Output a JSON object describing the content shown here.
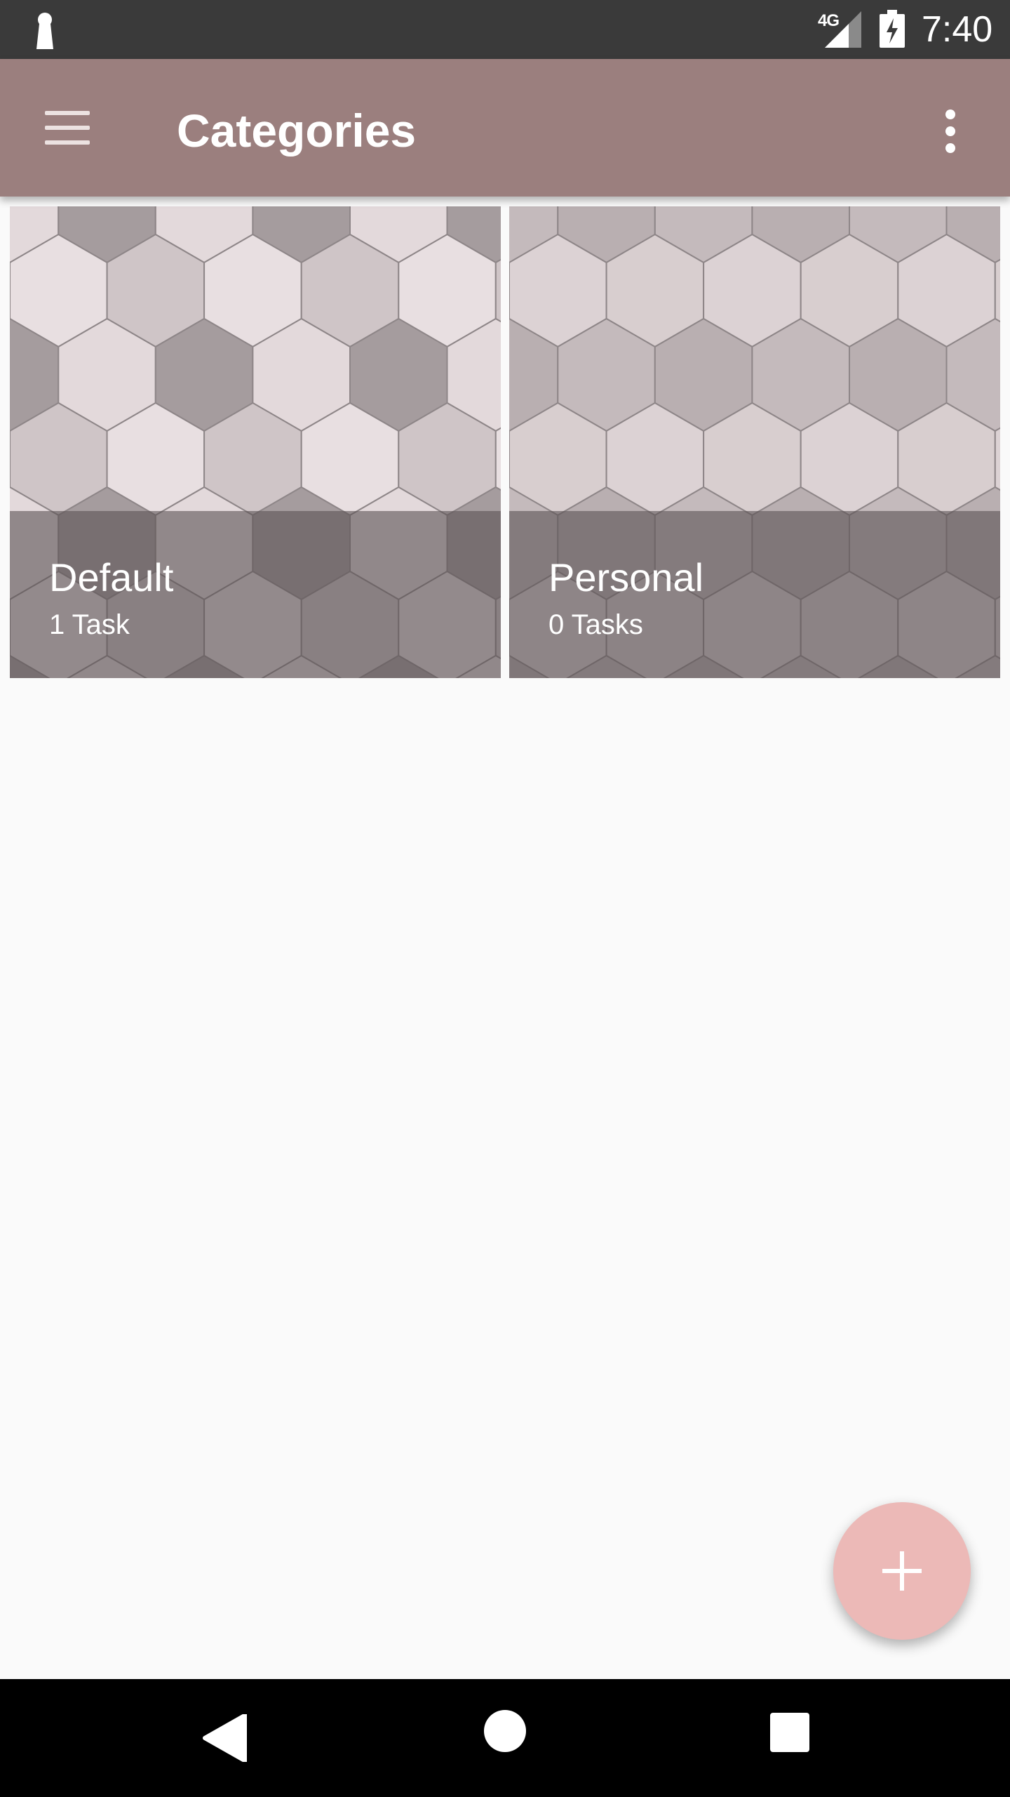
{
  "status_bar": {
    "network": "4G",
    "time": "7:40"
  },
  "app_bar": {
    "title": "Categories"
  },
  "categories": [
    {
      "name": "Default",
      "count": "1 Task"
    },
    {
      "name": "Personal",
      "count": "0 Tasks"
    }
  ],
  "colors": {
    "app_bar": "#9b7f7e",
    "status_bar": "#3a3a3a",
    "fab": "#ecb9b7",
    "background": "#fafafa"
  },
  "icons": {
    "menu": "hamburger-menu-icon",
    "overflow": "more-vert-icon",
    "fab": "plus-icon",
    "nav": [
      "back-triangle-icon",
      "home-circle-icon",
      "recents-square-icon"
    ]
  }
}
